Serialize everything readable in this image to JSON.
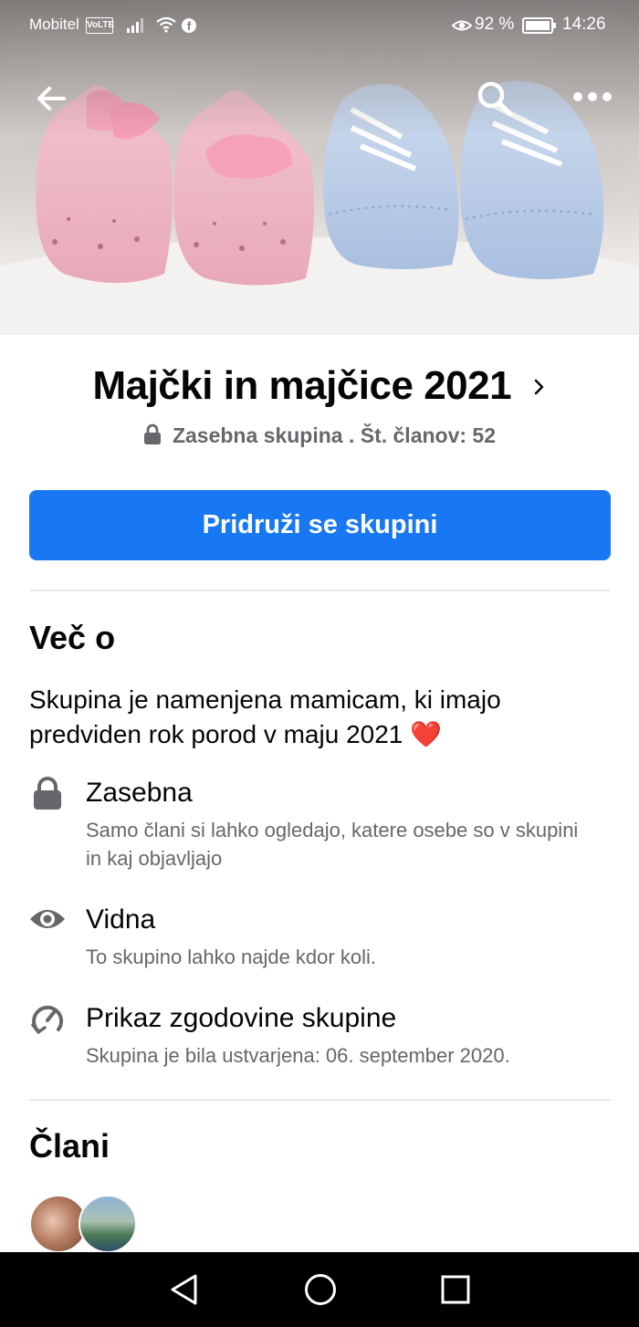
{
  "status_bar": {
    "carrier": "Mobitel",
    "volte": "VoLTE",
    "facebook_badge": "f",
    "battery": "92 %",
    "time": "14:26"
  },
  "cover": {
    "image": "baby-shoes-photo"
  },
  "group": {
    "title": "Majčki in majčice 2021",
    "privacy_line": "Zasebna skupina . Št. članov: 52"
  },
  "join_button": "Pridruži se skupini",
  "about": {
    "heading": "Več o",
    "description": "Skupina je namenjena mamicam, ki imajo predviden rok porod v maju 2021",
    "heart": "❤️",
    "items": [
      {
        "icon": "lock-icon",
        "title": "Zasebna",
        "desc": "Samo člani si lahko ogledajo, katere osebe so v skupini in kaj objavljajo"
      },
      {
        "icon": "eye-icon",
        "title": "Vidna",
        "desc": "To skupino lahko najde kdor koli."
      },
      {
        "icon": "history-icon",
        "title": "Prikaz zgodovine skupine",
        "desc": "Skupina je bila ustvarjena: 06. september 2020."
      }
    ]
  },
  "members": {
    "heading": "Člani"
  },
  "colors": {
    "primary": "#1877f2",
    "text": "#050505",
    "secondary_text": "#65676b",
    "divider": "#e4e6eb"
  }
}
